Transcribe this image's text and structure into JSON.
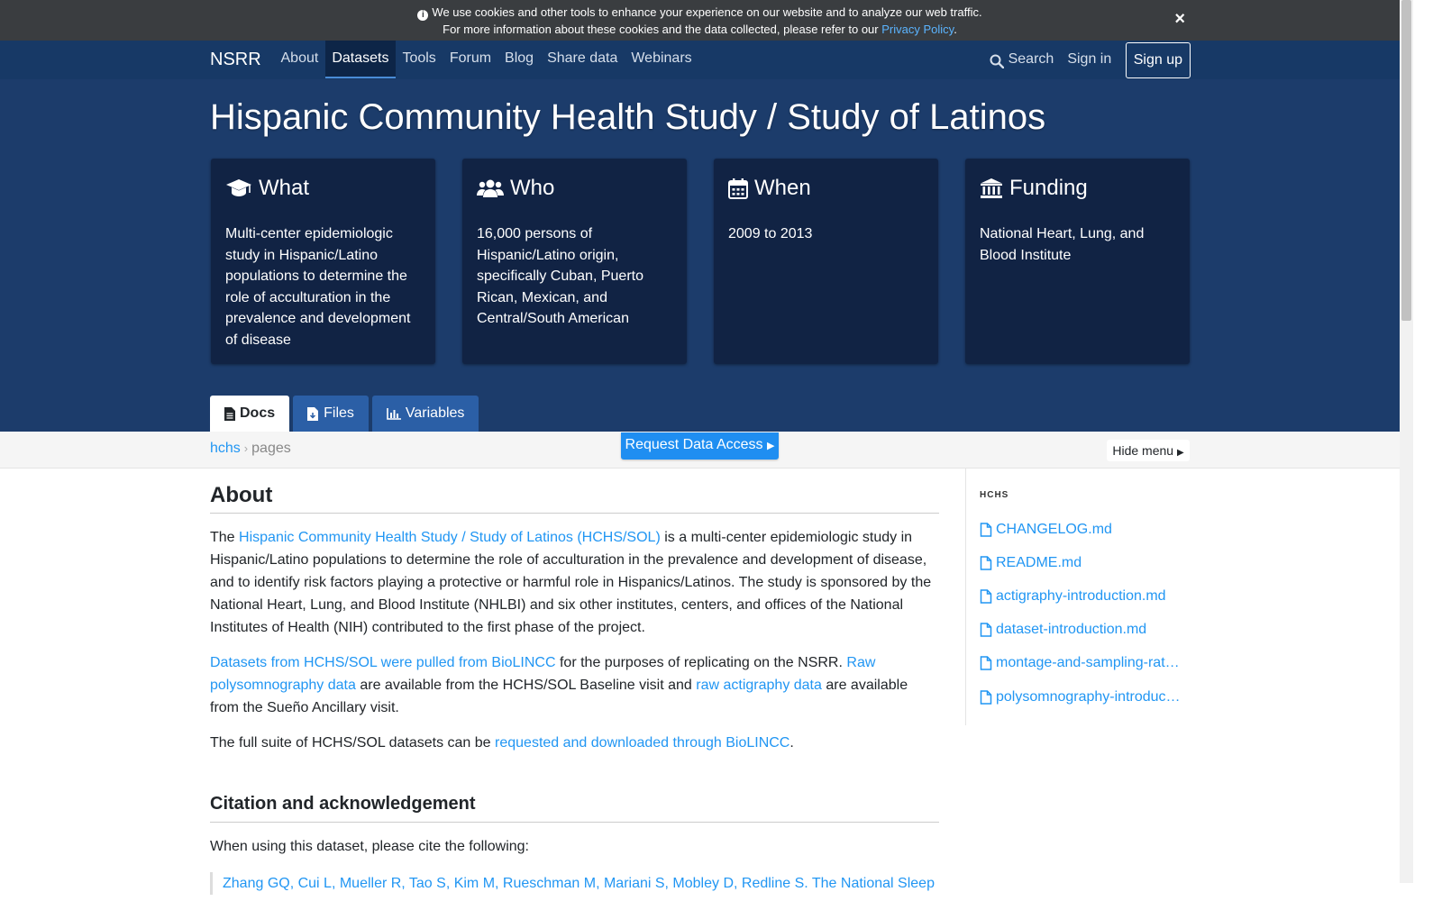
{
  "cookie": {
    "line1": "We use cookies and other tools to enhance your experience on our website and to analyze our web traffic.",
    "line2_prefix": "For more information about these cookies and the data collected, please refer to our",
    "link": "Privacy Policy",
    "line2_suffix": ".",
    "close": "×"
  },
  "nav": {
    "brand": "NSRR",
    "links": [
      "About",
      "Datasets",
      "Tools",
      "Forum",
      "Blog",
      "Share data",
      "Webinars"
    ],
    "active": "Datasets",
    "search": "Search",
    "signin": "Sign in",
    "signup": "Sign up"
  },
  "hero": {
    "title": "Hispanic Community Health Study / Study of Latinos",
    "cards": [
      {
        "icon": "graduation-cap-icon",
        "title": "What",
        "body": "Multi-center epidemiologic study in Hispanic/Latino populations to determine the role of acculturation in the prevalence and development of disease"
      },
      {
        "icon": "users-icon",
        "title": "Who",
        "body": "16,000 persons of Hispanic/Latino origin, specifically Cuban, Puerto Rican, Mexican, and Central/South American"
      },
      {
        "icon": "calendar-icon",
        "title": "When",
        "body": "2009 to 2013"
      },
      {
        "icon": "university-icon",
        "title": "Funding",
        "body": "National Heart, Lung, and Blood Institute"
      }
    ]
  },
  "tabs": [
    {
      "label": "Docs",
      "icon": "document-icon",
      "active": true
    },
    {
      "label": "Files",
      "icon": "file-download-icon",
      "active": false
    },
    {
      "label": "Variables",
      "icon": "bar-chart-icon",
      "active": false
    }
  ],
  "subbar": {
    "crumb_link": "hchs",
    "crumb_sep": "›",
    "crumb_current": "pages",
    "request_button": "Request Data Access",
    "hide_menu": "Hide menu"
  },
  "content": {
    "about_heading": "About",
    "p1_prefix": "The",
    "p1_link": "Hispanic Community Health Study / Study of Latinos (HCHS/SOL)",
    "p1_rest": "is a multi-center epidemiologic study in Hispanic/Latino populations to determine the role of acculturation in the prevalence and development of disease, and to identify risk factors playing a protective or harmful role in Hispanics/Latinos. The study is sponsored by the National Heart, Lung, and Blood Institute (NHLBI) and six other institutes, centers, and offices of the National Institutes of Health (NIH) contributed to the first phase of the project.",
    "p2_link1": "Datasets from HCHS/SOL were pulled from BioLINCC",
    "p2_text1": "for the purposes of replicating on the NSRR.",
    "p2_link2": "Raw polysomnography data",
    "p2_text2": "are available from the HCHS/SOL Baseline visit and",
    "p2_link3": "raw actigraphy data",
    "p2_text3": "are available from the Sueño Ancillary visit.",
    "p3_prefix": "The full suite of HCHS/SOL datasets can be",
    "p3_link": "requested and downloaded through BioLINCC",
    "p3_suffix": ".",
    "citation_heading": "Citation and acknowledgement",
    "citation_intro": "When using this dataset, please cite the following:",
    "citation_link": "Zhang GQ, Cui L, Mueller R, Tao S, Kim M, Rueschman M, Mariani S, Mobley D, Redline S. The National Sleep"
  },
  "sidebar": {
    "heading": "HCHS",
    "files": [
      "CHANGELOG.md",
      "README.md",
      "actigraphy-introduction.md",
      "dataset-introduction.md",
      "montage-and-sampling-rat…",
      "polysomnography-introduc…"
    ]
  },
  "colors": {
    "navbar": "#173966",
    "hero": "#1c3c6b",
    "card": "#112344",
    "link": "#2196f3",
    "request_button": "#1f8ef1"
  }
}
